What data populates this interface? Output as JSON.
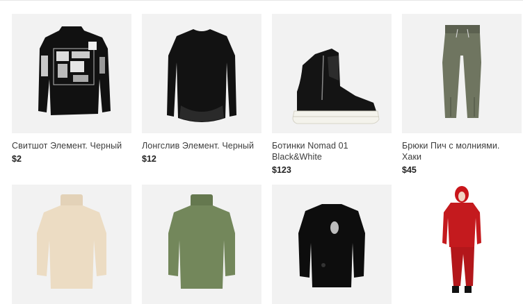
{
  "products": [
    {
      "name": "Свитшот Элемент. Черный",
      "price": "$2",
      "image_icon": "black-sweatshirt-patches-icon"
    },
    {
      "name": "Лонгслив Элемент. Черный",
      "price": "$12",
      "image_icon": "black-longsleeve-icon"
    },
    {
      "name": "Ботинки Nomad 01 Black&White",
      "price": "$123",
      "image_icon": "black-white-sneaker-boot-icon"
    },
    {
      "name": "Брюки Пич с молниями. Хаки",
      "price": "$45",
      "image_icon": "khaki-zip-pants-icon"
    },
    {
      "name": "",
      "price": "",
      "image_icon": "beige-turtleneck-sweater-icon"
    },
    {
      "name": "",
      "price": "",
      "image_icon": "green-turtleneck-sweater-icon"
    },
    {
      "name": "",
      "price": "",
      "image_icon": "black-distressed-sweater-icon"
    },
    {
      "name": "",
      "price": "",
      "image_icon": "red-hoodie-model-icon"
    }
  ],
  "colors": {
    "card_bg": "#f2f2f2",
    "text": "#3c3c3c",
    "price": "#222222"
  }
}
